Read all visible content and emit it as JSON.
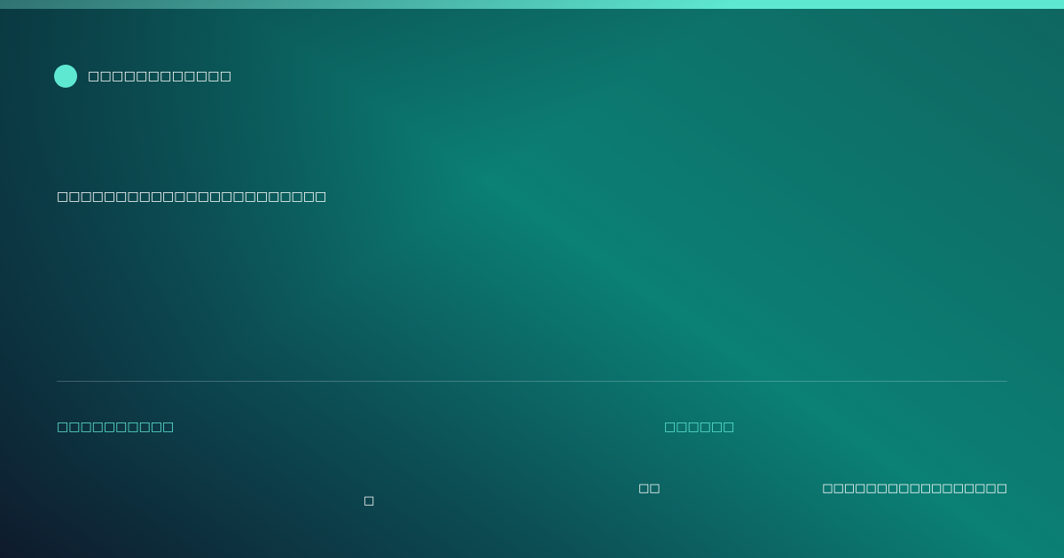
{
  "colors": {
    "accent": "#5ee8d2",
    "text": "#ffffff",
    "background_dark": "#0e1a2c",
    "background_teal": "#0b8075"
  },
  "brand": {
    "icon": "circle-logo-icon",
    "name": "□□□□□□□□□□□□"
  },
  "headline": "□□□□□□□□□□□□□□□□□□□□□□□",
  "footer": {
    "left_label": "□□□□□□□□□□",
    "right_label": "□□□□□□",
    "meta_a": "□",
    "meta_b": "□□",
    "meta_c": "□□□□□□□□□□□□□□□□□"
  }
}
